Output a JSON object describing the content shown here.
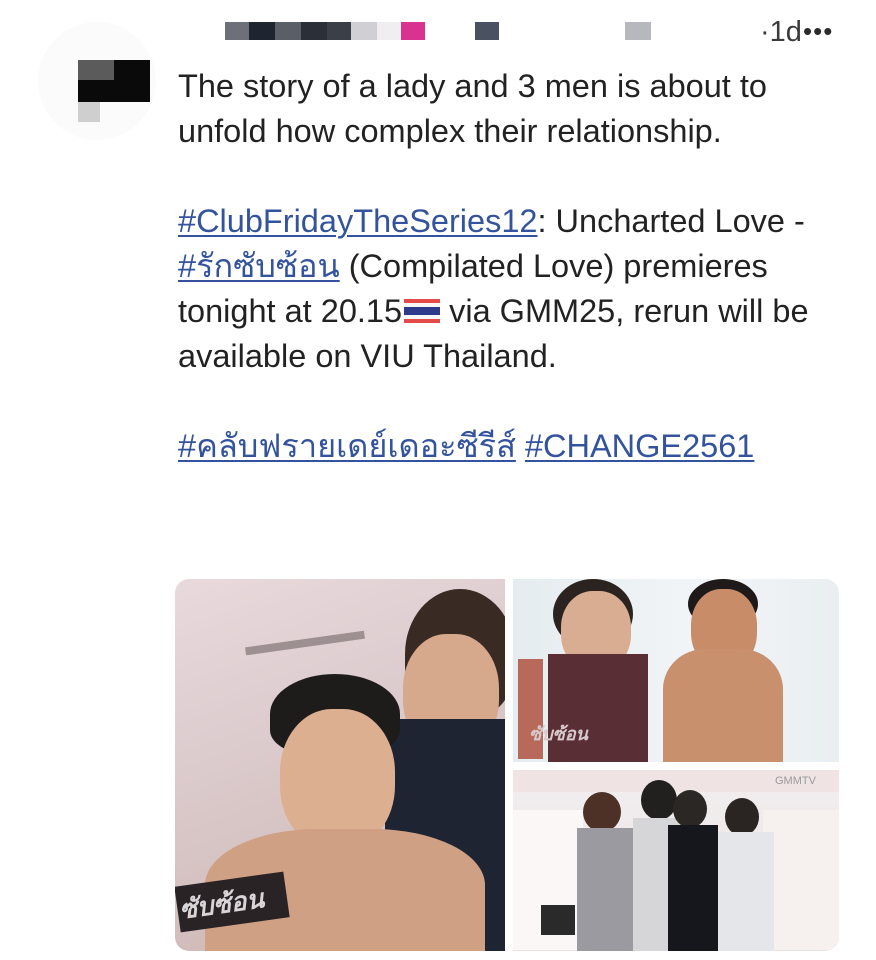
{
  "header": {
    "time": "·1d",
    "more": "•••",
    "redacted_colors": [
      "#3b3f48",
      "#1e2430",
      "#6d7078",
      "#2b2f38",
      "#cfcfd4",
      "#f0eef0",
      "#d9338f",
      "#4a5160",
      "#b6b8be"
    ]
  },
  "post": {
    "line1": "The story of a lady and 3 men is about to unfold how complex their relationship.",
    "tag1": "#ClubFridayTheSeries12",
    "text1": ": Uncharted Love - ",
    "tag2": "#รักซับซ้อน",
    "text2": " (Compilated Love) premieres tonight at 20.15",
    "text3": " via GMM25, rerun will be available on VIU Thailand.",
    "tag3": "#คลับฟรายเดย์เดอะซีรีส์",
    "tag4": "#CHANGE2561"
  },
  "gallery": {
    "overlay_text": "ซับซ้อน",
    "overlay_text_2": "ซับซ้อน",
    "watermark": "GMMTV"
  },
  "colors": {
    "link": "#33539e",
    "text": "#222222"
  },
  "icons": [
    "thailand-flag-icon",
    "more-options-icon"
  ]
}
